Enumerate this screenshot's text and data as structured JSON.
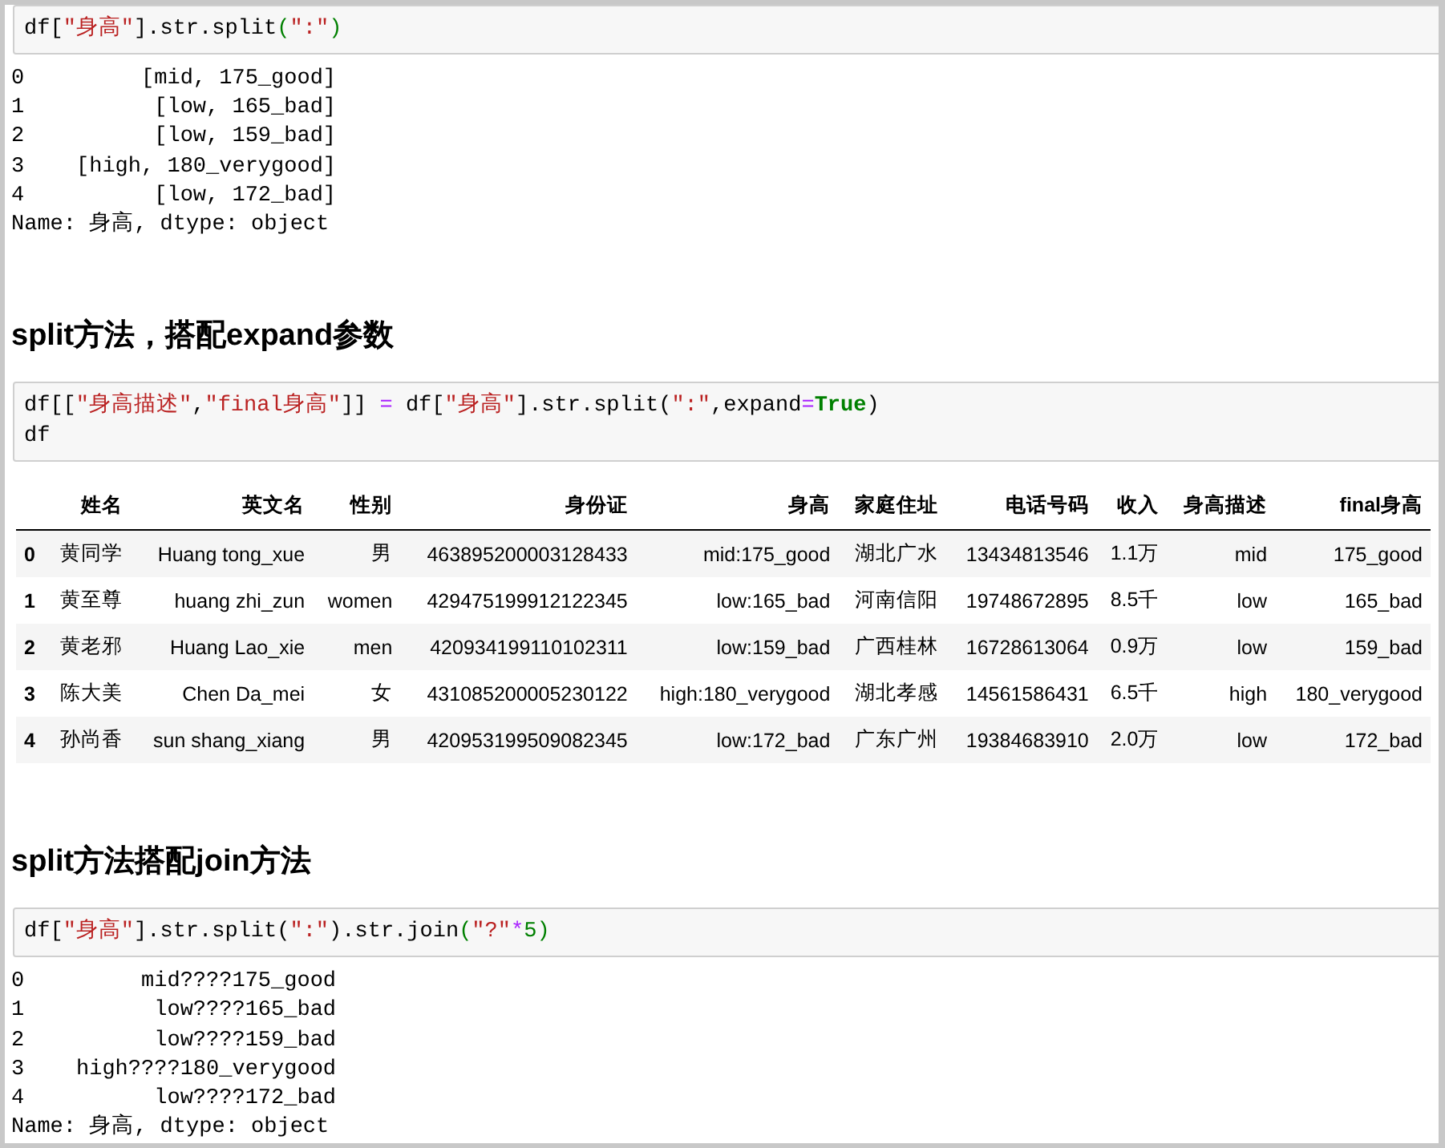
{
  "cells": [
    {
      "kind": "code",
      "lines": [
        [
          {
            "t": "df[",
            "kind": "plain"
          },
          {
            "t": "\"身高\"",
            "kind": "string"
          },
          {
            "t": "].str.split",
            "kind": "plain"
          },
          {
            "t": "(",
            "kind": "match"
          },
          {
            "t": "\":\"",
            "kind": "string"
          },
          {
            "t": ")",
            "kind": "match"
          }
        ]
      ]
    },
    {
      "kind": "output",
      "lines": [
        "0         [mid, 175_good]",
        "1          [low, 165_bad]",
        "2          [low, 159_bad]",
        "3    [high, 180_verygood]",
        "4          [low, 172_bad]",
        "Name: 身高, dtype: object"
      ]
    },
    {
      "kind": "heading",
      "text": "split方法，搭配expand参数"
    },
    {
      "kind": "code",
      "lines": [
        [
          {
            "t": "df[[",
            "kind": "plain"
          },
          {
            "t": "\"身高描述\"",
            "kind": "string"
          },
          {
            "t": ",",
            "kind": "plain"
          },
          {
            "t": "\"final身高\"",
            "kind": "string"
          },
          {
            "t": "]] ",
            "kind": "plain"
          },
          {
            "t": "=",
            "kind": "operator"
          },
          {
            "t": " df[",
            "kind": "plain"
          },
          {
            "t": "\"身高\"",
            "kind": "string"
          },
          {
            "t": "].str.split(",
            "kind": "plain"
          },
          {
            "t": "\":\"",
            "kind": "string"
          },
          {
            "t": ",expand",
            "kind": "plain"
          },
          {
            "t": "=",
            "kind": "operator"
          },
          {
            "t": "True",
            "kind": "keyword"
          },
          {
            "t": ")",
            "kind": "plain"
          }
        ],
        [
          {
            "t": "df",
            "kind": "plain"
          }
        ]
      ]
    },
    {
      "kind": "table",
      "columns": [
        "姓名",
        "英文名",
        "性别",
        "身份证",
        "身高",
        "家庭住址",
        "电话号码",
        "收入",
        "身高描述",
        "final身高"
      ],
      "rows": [
        {
          "index": "0",
          "cells": [
            "黄同学",
            "Huang tong_xue",
            "男",
            "463895200003128433",
            "mid:175_good",
            "湖北广水",
            "13434813546",
            "1.1万",
            "mid",
            "175_good"
          ]
        },
        {
          "index": "1",
          "cells": [
            "黄至尊",
            "huang zhi_zun",
            "women",
            "429475199912122345",
            "low:165_bad",
            "河南信阳",
            "19748672895",
            "8.5千",
            "low",
            "165_bad"
          ]
        },
        {
          "index": "2",
          "cells": [
            "黄老邪",
            "Huang Lao_xie",
            "men",
            "420934199110102311",
            "low:159_bad",
            "广西桂林",
            "16728613064",
            "0.9万",
            "low",
            "159_bad"
          ]
        },
        {
          "index": "3",
          "cells": [
            "陈大美",
            "Chen Da_mei",
            "女",
            "431085200005230122",
            "high:180_verygood",
            "湖北孝感",
            "14561586431",
            "6.5千",
            "high",
            "180_verygood"
          ]
        },
        {
          "index": "4",
          "cells": [
            "孙尚香",
            "sun shang_xiang",
            "男",
            "420953199509082345",
            "low:172_bad",
            "广东广州",
            "19384683910",
            "2.0万",
            "low",
            "172_bad"
          ]
        }
      ]
    },
    {
      "kind": "heading",
      "text": "split方法搭配join方法"
    },
    {
      "kind": "code",
      "lines": [
        [
          {
            "t": "df[",
            "kind": "plain"
          },
          {
            "t": "\"身高\"",
            "kind": "string"
          },
          {
            "t": "].str.split(",
            "kind": "plain"
          },
          {
            "t": "\":\"",
            "kind": "string"
          },
          {
            "t": ").str.join",
            "kind": "plain"
          },
          {
            "t": "(",
            "kind": "match"
          },
          {
            "t": "\"?\"",
            "kind": "string"
          },
          {
            "t": "*",
            "kind": "operator"
          },
          {
            "t": "5",
            "kind": "number"
          },
          {
            "t": ")",
            "kind": "match"
          }
        ]
      ]
    },
    {
      "kind": "output",
      "lines": [
        "0         mid????175_good",
        "1          low????165_bad",
        "2          low????159_bad",
        "3    high????180_verygood",
        "4          low????172_bad",
        "Name: 身高, dtype: object"
      ]
    }
  ]
}
